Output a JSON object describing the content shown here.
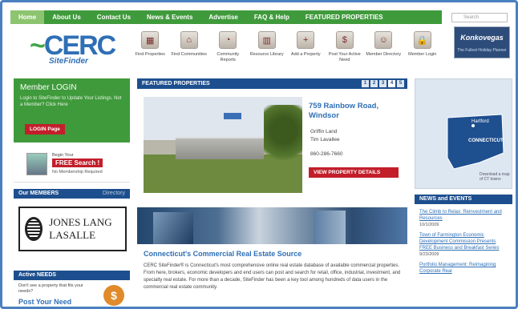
{
  "nav": {
    "items": [
      "Home",
      "About Us",
      "Contact Us",
      "News & Events",
      "Advertise",
      "FAQ & Help",
      "FEATURED PROPERTIES"
    ]
  },
  "search": {
    "placeholder": "Search"
  },
  "logo": {
    "mark": "CERC",
    "sub": "SiteFinder"
  },
  "iconbar": {
    "items": [
      {
        "label": "Find Properties",
        "icon": "building-icon"
      },
      {
        "label": "Find Communities",
        "icon": "houses-icon"
      },
      {
        "label": "Community Reports",
        "icon": "chart-icon"
      },
      {
        "label": "Resource Library",
        "icon": "books-icon"
      },
      {
        "label": "Add a Property",
        "icon": "add-icon"
      },
      {
        "label": "Post Your Active Need",
        "icon": "dollar-icon"
      },
      {
        "label": "Member Directory",
        "icon": "people-icon"
      },
      {
        "label": "Member Login",
        "icon": "lock-icon"
      }
    ]
  },
  "ad_top": {
    "title": "Konkovegas",
    "sub": "The Fullest Holiday Planner"
  },
  "login": {
    "heading": "Member LOGIN",
    "text": "Login to SiteFinder to Update Your Listings. Not a Member? Click Here",
    "button": "LOGIN Page"
  },
  "free_search": {
    "line1": "Begin Your",
    "highlight": "FREE Search !",
    "line2": "No Membership Required"
  },
  "members": {
    "heading": "Our MEMBERS",
    "directory": "Directory",
    "sponsor": "JONES LANG LASALLE"
  },
  "needs": {
    "heading": "Active NEEDS",
    "text": "Don't see a property that fits your needs?",
    "button": "Post Your Need"
  },
  "featured": {
    "heading": "FEATURED PROPERTIES",
    "pages": [
      "1",
      "2",
      "3",
      "4",
      "5"
    ],
    "address": "759 Rainbow Road, Windsor",
    "detail1": "Griffin Land",
    "detail2": "Tim Lavallee",
    "phone": "860-286-7660",
    "button": "VIEW PROPERTY DETAILS"
  },
  "source": {
    "title": "Connecticut's Commercial Real Estate Source",
    "body": "CERC SiteFinder® is Connecticut's most comprehensive online real estate database of available commercial properties. From here, brokers, economic developers and end users can post and search for retail, office, industrial, investment, and specialty real estate. For more than a decade, SiteFinder has been a key tool among hundreds of data users in the commercial real estate community."
  },
  "map": {
    "city": "Hartford",
    "state": "CONNECTICUT",
    "caption": "Download a map of CT towns"
  },
  "news": {
    "heading": "NEWS and EVENTS",
    "items": [
      {
        "title": "The Climb to Relax: Reinvestment and Resources",
        "date": "10/1/2009"
      },
      {
        "title": "Town of Farmington Economic Development Commission Presents FREE Business and Breakfast Series",
        "date": "9/23/2009"
      },
      {
        "title": "Portfolio Management: Reimagining Corporate Real",
        "date": ""
      }
    ]
  },
  "colors": {
    "green": "#3f9a3b",
    "blue": "#1d4f8e",
    "red": "#c21f2b",
    "link": "#2f6fb5"
  }
}
